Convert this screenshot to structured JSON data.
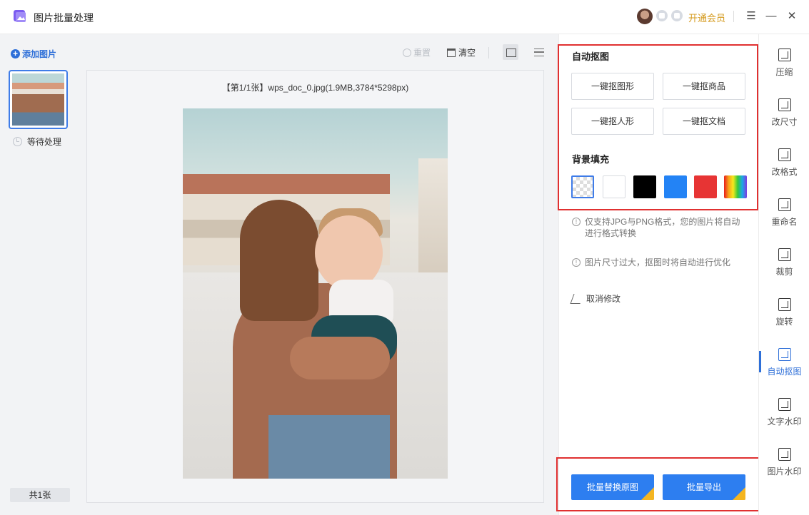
{
  "app": {
    "title": "图片批量处理",
    "vip_label": "开通会员"
  },
  "window_controls": {
    "menu": "☰",
    "minimize": "—",
    "close": "✕"
  },
  "left": {
    "add_label": "添加图片",
    "items": [
      {
        "status": "等待处理"
      }
    ],
    "count_label": "共1张"
  },
  "center": {
    "reset_label": "重置",
    "clear_label": "清空",
    "caption": "【第1/1张】wps_doc_0.jpg(1.9MB,3784*5298px)"
  },
  "options": {
    "matting_title": "自动抠图",
    "matting_buttons": [
      "一键抠图形",
      "一键抠商品",
      "一键抠人形",
      "一键抠文档"
    ],
    "background_title": "背景填充",
    "background_colors": [
      {
        "name": "transparent"
      },
      {
        "name": "white",
        "hex": "#ffffff"
      },
      {
        "name": "black",
        "hex": "#000000"
      },
      {
        "name": "blue",
        "hex": "#2383f5"
      },
      {
        "name": "red",
        "hex": "#e73434"
      },
      {
        "name": "rainbow"
      }
    ],
    "notes": [
      "仅支持JPG与PNG格式，您的图片将自动进行格式转换",
      "图片尺寸过大，抠图时将自动进行优化"
    ],
    "undo_label": "取消修改",
    "replace_label": "批量替换原图",
    "export_label": "批量导出"
  },
  "rail": {
    "items": [
      {
        "label": "压缩",
        "icon": "compress-icon"
      },
      {
        "label": "改尺寸",
        "icon": "resize-icon"
      },
      {
        "label": "改格式",
        "icon": "format-icon"
      },
      {
        "label": "重命名",
        "icon": "rename-icon"
      },
      {
        "label": "裁剪",
        "icon": "crop-icon"
      },
      {
        "label": "旋转",
        "icon": "rotate-icon"
      },
      {
        "label": "自动抠图",
        "icon": "auto-matting-icon",
        "active": true
      },
      {
        "label": "文字水印",
        "icon": "text-watermark-icon"
      },
      {
        "label": "图片水印",
        "icon": "image-watermark-icon"
      }
    ]
  },
  "colors": {
    "accent": "#2e6fd8",
    "button": "#2d7ef0",
    "vip": "#d59b1f",
    "highlight": "#e03030"
  }
}
